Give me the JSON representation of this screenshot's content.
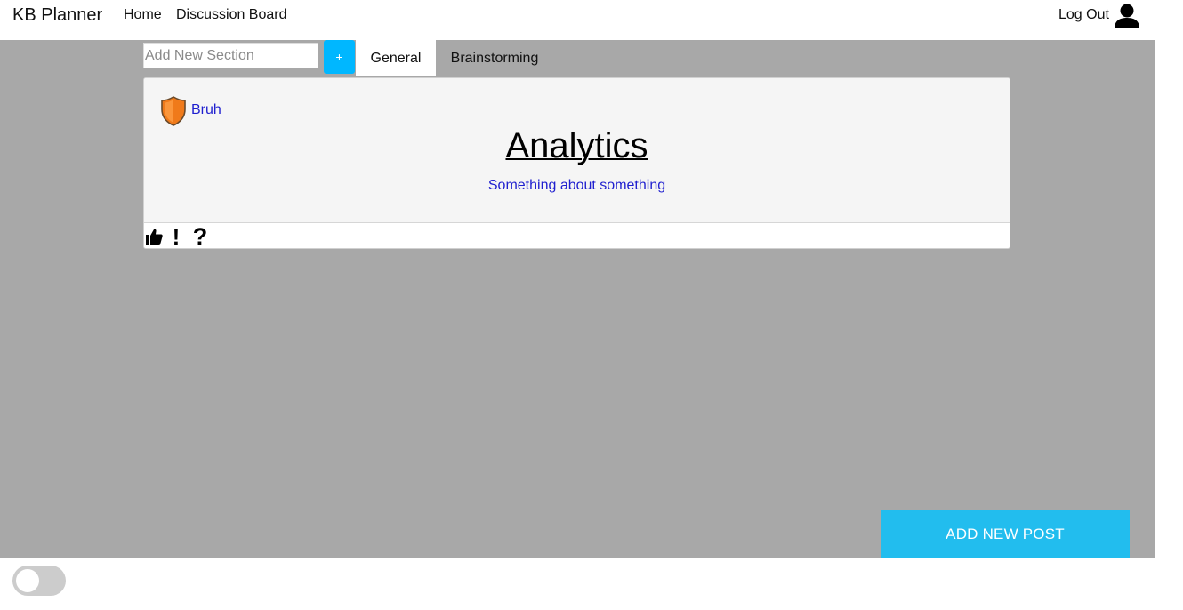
{
  "navbar": {
    "brand": "KB Planner",
    "links": [
      "Home",
      "Discussion Board"
    ],
    "logout_label": "Log Out",
    "user_icon": "user-icon"
  },
  "sections": {
    "input_placeholder": "Add New Section",
    "input_value": "",
    "add_label": "+",
    "tabs": [
      {
        "label": "General",
        "active": true
      },
      {
        "label": "Brainstorming",
        "active": false
      }
    ]
  },
  "post": {
    "author": "Bruh",
    "author_icon": "shield-icon",
    "title": "Analytics",
    "description": "Something about something",
    "reactions": [
      {
        "icon": "thumbs-up-icon",
        "glyph": "👍"
      },
      {
        "icon": "exclamation-icon",
        "glyph": "!"
      },
      {
        "icon": "question-icon",
        "glyph": "?"
      }
    ]
  },
  "actions": {
    "add_post_label": "ADD NEW POST"
  },
  "toggle": {
    "checked": false
  },
  "colors": {
    "main_background": "#a8a8a8",
    "accent_button": "#00b7ff",
    "add_post_button": "#22bdee",
    "link_blue": "#1f1fcf",
    "shield_orange": "#f07a1a"
  }
}
